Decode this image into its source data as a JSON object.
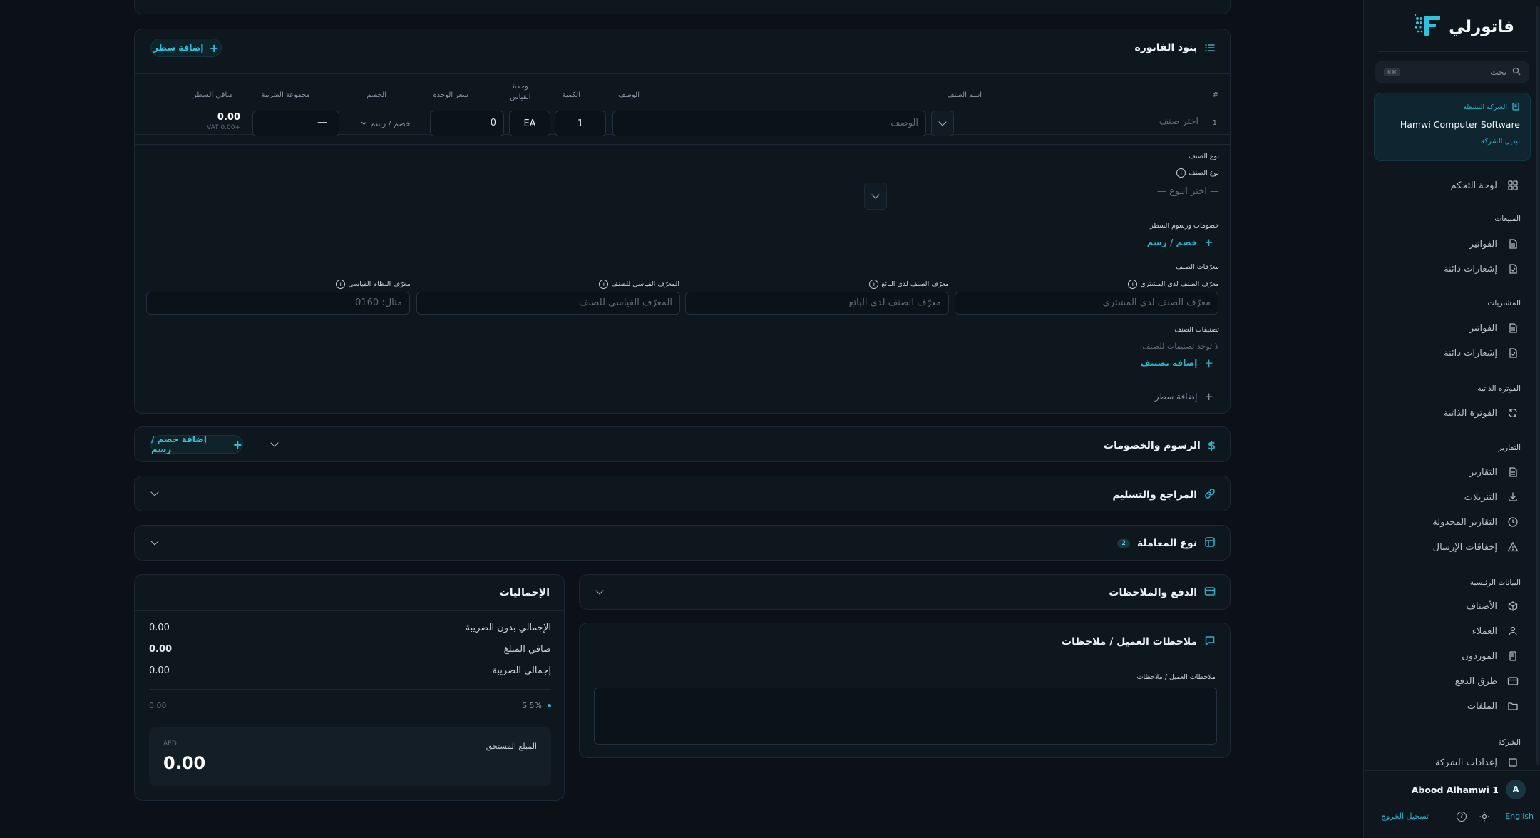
{
  "invoice_items": {
    "title": "بنود الفاتورة",
    "add_line_button": "إضافة سطر",
    "columns": {
      "index": "#",
      "item_name": "اسم الصنف",
      "description": "الوصف",
      "quantity": "الكمية",
      "unit_line1": "وحدة",
      "unit_line2": "القياس",
      "unit_price": "سعر الوحدة",
      "discount": "الخصم",
      "tax_group": "مجموعة الضريبة",
      "line_net": "صافي السطر"
    },
    "row": {
      "index": "1",
      "item_placeholder": "اختر صنف",
      "description_placeholder": "الوصف",
      "quantity": "1",
      "unit": "EA",
      "unit_price": "0",
      "discount_select": "خصم / رسم",
      "tax_value": "—",
      "line_net": "0.00",
      "line_vat": "VAT 0.00+"
    },
    "details": {
      "item_type_section": "نوع الصنف",
      "item_type_label": "نوع الصنف",
      "item_type_placeholder": "— اختر النوع —",
      "line_discounts_section": "خصومات ورسوم السطر",
      "add_discount_link": "خصم / رسم",
      "identifiers_section": "معرّفات الصنف",
      "buyer_id_label": "معرّف الصنف لدى المشتري",
      "buyer_id_placeholder": "معرّف الصنف لدى المشتري",
      "seller_id_label": "معرّف الصنف لدى البائع",
      "seller_id_placeholder": "معرّف الصنف لدى البائع",
      "standard_id_label": "المعرّف القياسي للصنف",
      "standard_id_placeholder": "المعرّف القياسي للصنف",
      "system_id_label": "معرّف النظام القياسي",
      "system_id_placeholder": "مثال: 0160",
      "classifications_section": "تصنيفات الصنف",
      "no_classifications": "لا توجد تصنيفات للصنف.",
      "add_classification": "إضافة تصنيف"
    },
    "footer_add_line": "إضافة سطر"
  },
  "charges": {
    "title": "الرسوم والخصومات",
    "add_button": "إضافة خصم / رسم"
  },
  "references": {
    "title": "المراجع والتسليم"
  },
  "transaction_type": {
    "title": "نوع المعاملة",
    "badge": "2"
  },
  "payment": {
    "title": "الدفع والملاحظات"
  },
  "notes": {
    "title": "ملاحظات العميل / ملاحظات",
    "field_label": "ملاحظات العميل / ملاحظات"
  },
  "totals": {
    "title": "الإجماليات",
    "rows": [
      {
        "label": "الإجمالي بدون الضريبة",
        "value": "0.00"
      },
      {
        "label": "صافي المبلغ",
        "value": "0.00"
      },
      {
        "label": "إجمالي الضريبة",
        "value": "0.00"
      }
    ],
    "tax_line_label": "S 5%",
    "tax_line_value": "0.00",
    "amount_due_label": "المبلغ المستحق",
    "currency": "AED",
    "amount_due": "0.00"
  },
  "sidebar": {
    "brand": "فاتورلي",
    "search_placeholder": "بحث",
    "search_shortcut": "⌘K",
    "active_company_label": "الشركة النشطة",
    "company_name": "Hamwi Computer Software",
    "switch_company": "تبديل الشركة",
    "dashboard": "لوحة التحكم",
    "groups": [
      {
        "title": "المبيعات",
        "items": [
          "الفواتير",
          "إشعارات دائنة"
        ]
      },
      {
        "title": "المشتريات",
        "items": [
          "الفواتير",
          "إشعارات دائنة"
        ]
      },
      {
        "title": "الفوترة الذاتية",
        "items": [
          "الفوترة الذاتية"
        ]
      },
      {
        "title": "التقارير",
        "items": [
          "التقارير",
          "التنزيلات",
          "التقارير المجدولة",
          "إخفاقات الإرسال"
        ]
      },
      {
        "title": "البيانات الرئيسية",
        "items": [
          "الأصناف",
          "العملاء",
          "الموردون",
          "طرق الدفع",
          "الملفات"
        ]
      },
      {
        "title": "الشركة",
        "items": [
          "إعدادات الشركة"
        ]
      }
    ],
    "user_name": "Abood Alhamwi 1",
    "user_initial": "A",
    "language": "English",
    "logout": "تسجيل الخروج"
  },
  "colors": {
    "accent": "#2bb3c9",
    "background": "#0b1117",
    "card": "#0e161e"
  }
}
